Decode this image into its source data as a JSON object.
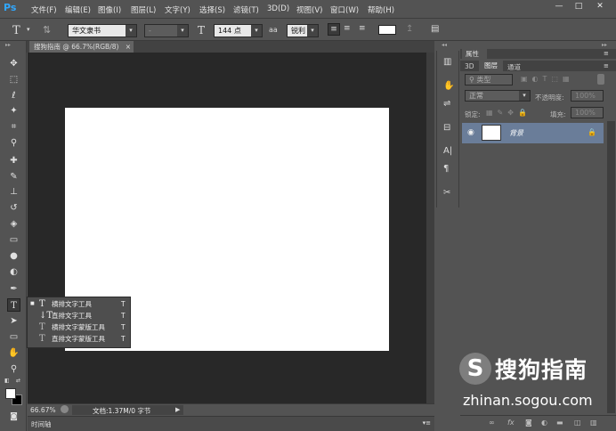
{
  "app": {
    "logo": "Ps"
  },
  "menu": [
    "文件(F)",
    "编辑(E)",
    "图像(I)",
    "图层(L)",
    "文字(Y)",
    "选择(S)",
    "滤镜(T)",
    "3D(D)",
    "视图(V)",
    "窗口(W)",
    "帮助(H)"
  ],
  "window_controls": {
    "minimize": "—",
    "restore": "□",
    "close": "✕"
  },
  "options": {
    "tool_icon": "T",
    "font_family": "华文隶书",
    "font_style": "-",
    "size_icon": "T",
    "font_size": "144 点",
    "aa_icon": "aa",
    "antialias": "锐利"
  },
  "document": {
    "tab_title": "搜狗指南 @ 66.7%(RGB/8)",
    "tab_close": "×",
    "background_color": "#ffffff"
  },
  "status": {
    "zoom": "66.67%",
    "doc_info": "文档:1.37M/0 字节"
  },
  "timeline": {
    "label": "时间轴"
  },
  "flyout": {
    "items": [
      {
        "label": "横排文字工具",
        "key": "T",
        "active": true
      },
      {
        "label": "直排文字工具",
        "key": "T",
        "active": false
      },
      {
        "label": "横排文字蒙版工具",
        "key": "T",
        "active": false
      },
      {
        "label": "直排文字蒙版工具",
        "key": "T",
        "active": false
      }
    ]
  },
  "panels": {
    "properties_title": "属性",
    "tabs": [
      "3D",
      "图层",
      "通道"
    ],
    "filter_kind": "类型",
    "blend_mode": "正常",
    "opacity_label": "不透明度:",
    "opacity_value": "100%",
    "lock_label": "锁定:",
    "fill_label": "填充:",
    "fill_value": "100%",
    "layer_name": "背景"
  },
  "watermark": {
    "logo": "S",
    "title": "搜狗指南",
    "url": "zhinan.sogou.com"
  },
  "colors": {
    "ui_dark": "#535353",
    "canvas_bg": "#282828",
    "layer_selected": "#6a7d99",
    "ps_blue": "#31a8ff"
  }
}
